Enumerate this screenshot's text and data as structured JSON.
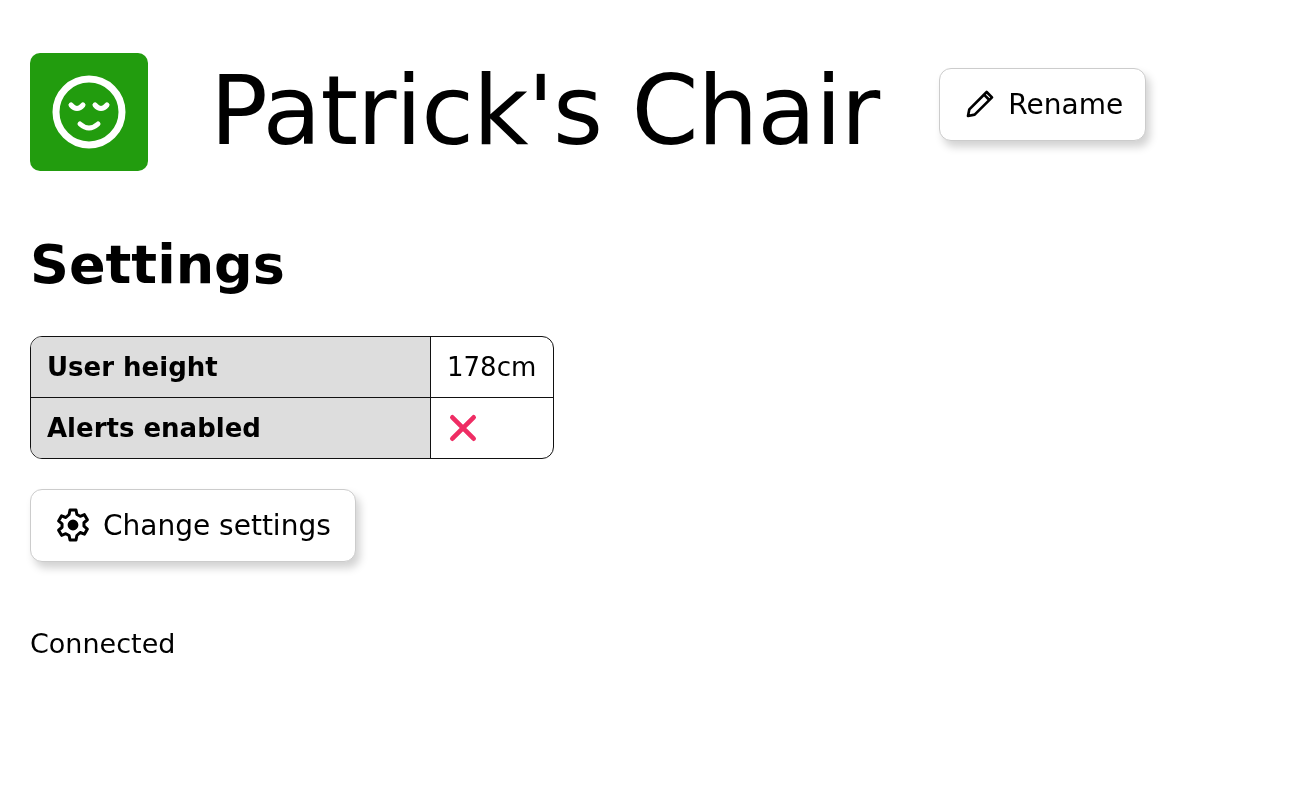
{
  "header": {
    "title": "Patrick's Chair",
    "rename_button": "Rename"
  },
  "settings": {
    "heading": "Settings",
    "rows": [
      {
        "kind": "text",
        "label": "User height",
        "value": "178cm"
      },
      {
        "kind": "boolean",
        "label": "Alerts enabled",
        "on": false
      }
    ],
    "change_button": "Change settings"
  },
  "status": "Connected"
}
